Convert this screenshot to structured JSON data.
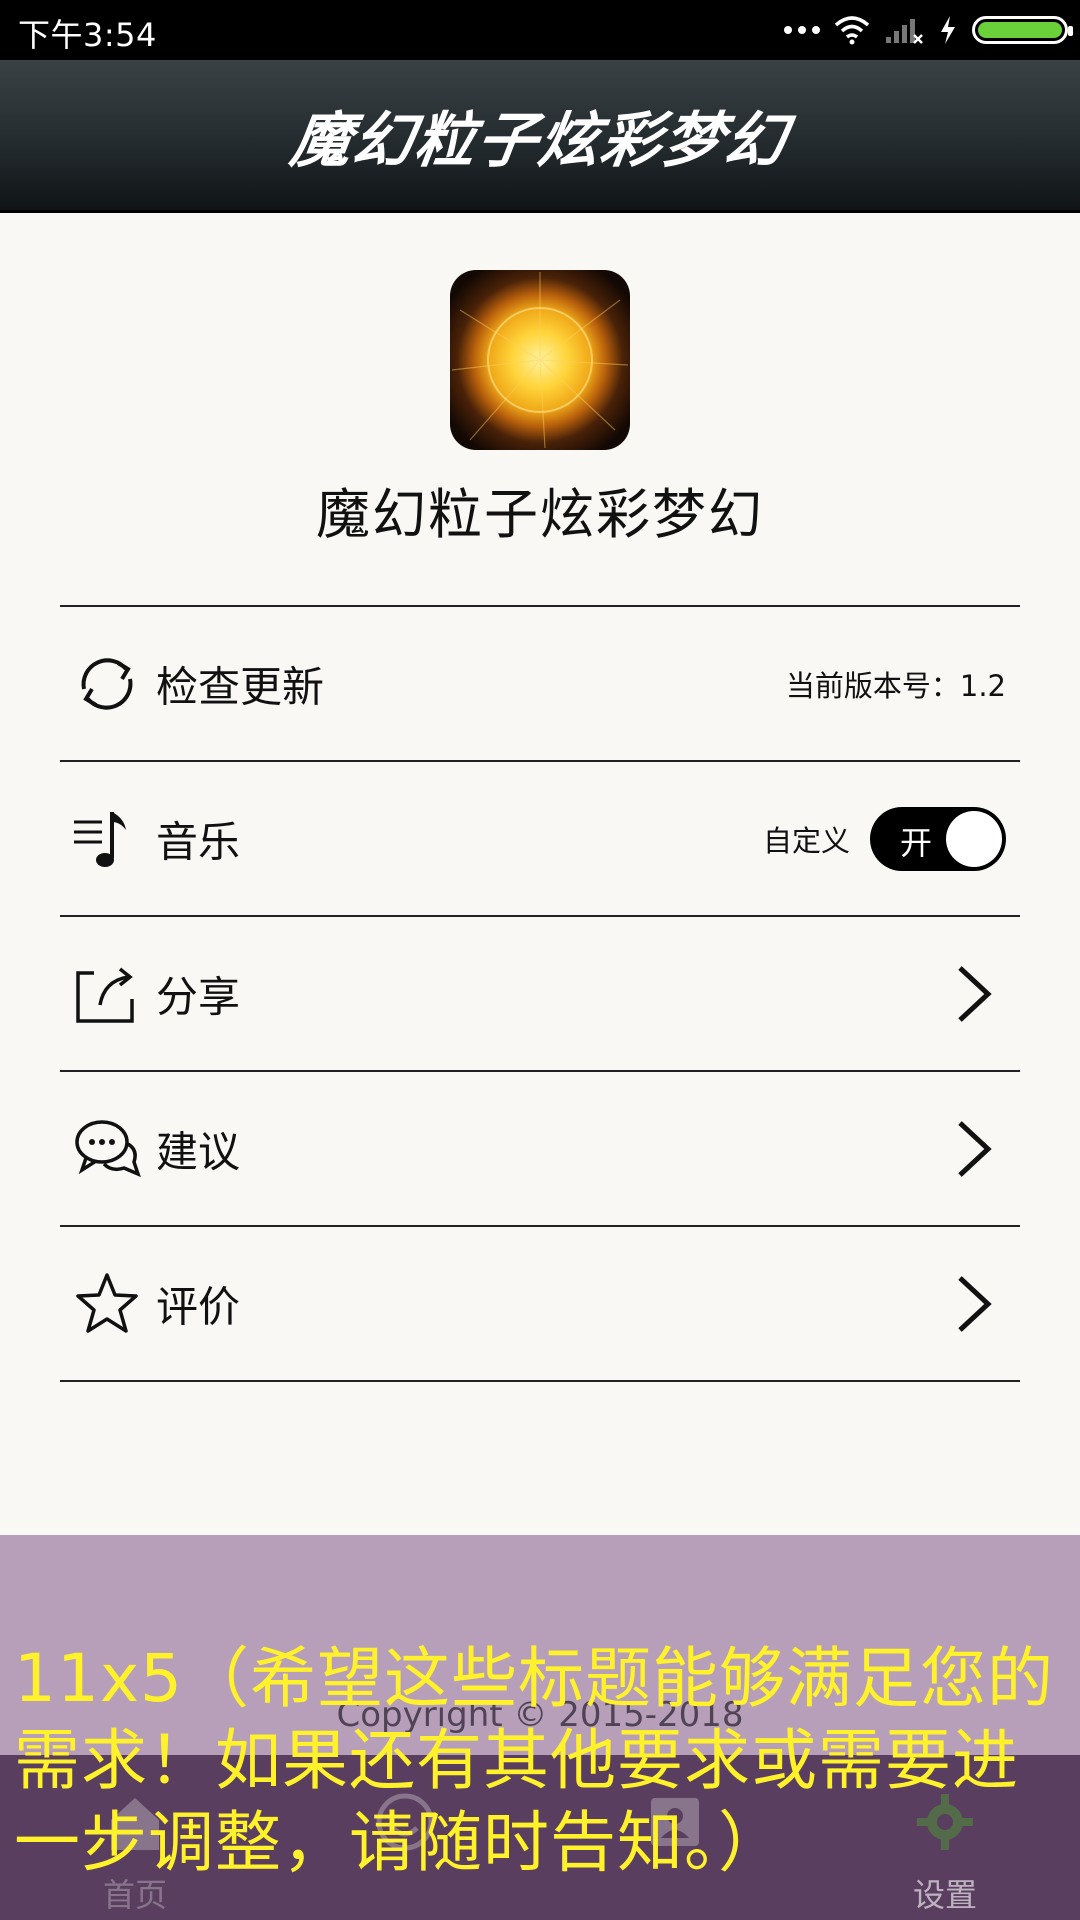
{
  "status_bar": {
    "time": "下午3:54",
    "icons": [
      "more-dots-icon",
      "wifi-icon",
      "signal-icon",
      "charging-icon",
      "battery-icon"
    ],
    "battery_color": "#6ad13a"
  },
  "header": {
    "title": "魔幻粒子炫彩梦幻"
  },
  "app_info": {
    "name": "魔幻粒子炫彩梦幻",
    "logo": "sun-logo"
  },
  "settings": {
    "check_update": {
      "label": "检查更新",
      "version_text": "当前版本号：1.2",
      "icon": "refresh-icon"
    },
    "music": {
      "label": "音乐",
      "toggle_label": "自定义",
      "toggle_state": "开",
      "icon": "music-list-icon"
    },
    "share": {
      "label": "分享",
      "icon": "share-icon"
    },
    "feedback": {
      "label": "建议",
      "icon": "chat-bubbles-icon"
    },
    "rate": {
      "label": "评价",
      "icon": "star-icon"
    }
  },
  "footer": {
    "copyright": "Copyright © 2015-2018"
  },
  "tabs": [
    {
      "label": "首页",
      "icon": "home-icon"
    },
    {
      "label": "",
      "icon": "smile-icon"
    },
    {
      "label": "",
      "icon": "contact-card-icon"
    },
    {
      "label": "设置",
      "icon": "gear-icon",
      "active": true
    }
  ],
  "overlay": {
    "caption": "11x5（希望这些标题能够满足您的需求！如果还有其他要求或需要进一步调整，请随时告知。）"
  },
  "colors": {
    "accent": "#000000",
    "bottom_panel": "#b79fba",
    "caption": "#fff22a"
  }
}
